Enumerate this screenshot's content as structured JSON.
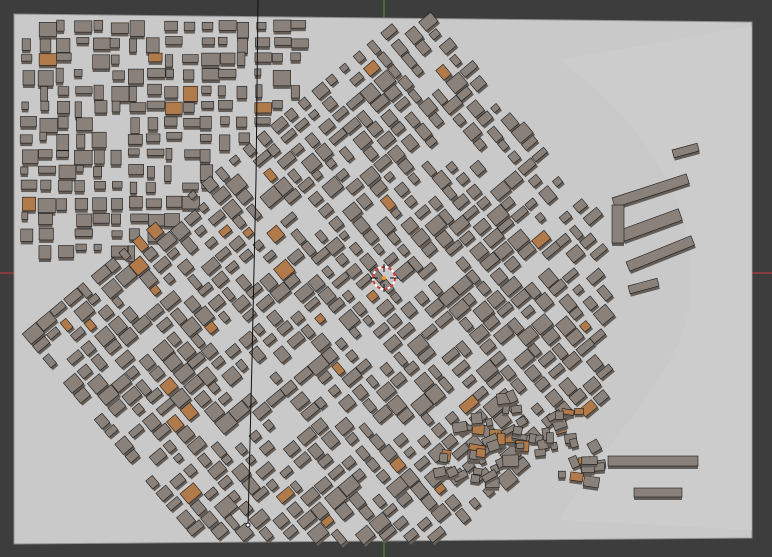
{
  "app": {
    "name": "3D viewport",
    "mode": "object"
  },
  "viewport": {
    "background_color": "#3d3d3d",
    "ground_color": "#c9c9c9",
    "building_top_color": "#8a817b",
    "building_side_color": "#655e58",
    "building_lit_color": "#b07a4a",
    "grid_x_axis_color": "#b23a3a",
    "grid_y_axis_color": "#4e8a2e",
    "outline_color": "#1a1a1a"
  },
  "scene": {
    "object": "city_block_model",
    "selected": false,
    "elements": [
      "ground-plane",
      "city-grid-buildings",
      "pier-buildings",
      "3d-cursor-icon"
    ]
  }
}
